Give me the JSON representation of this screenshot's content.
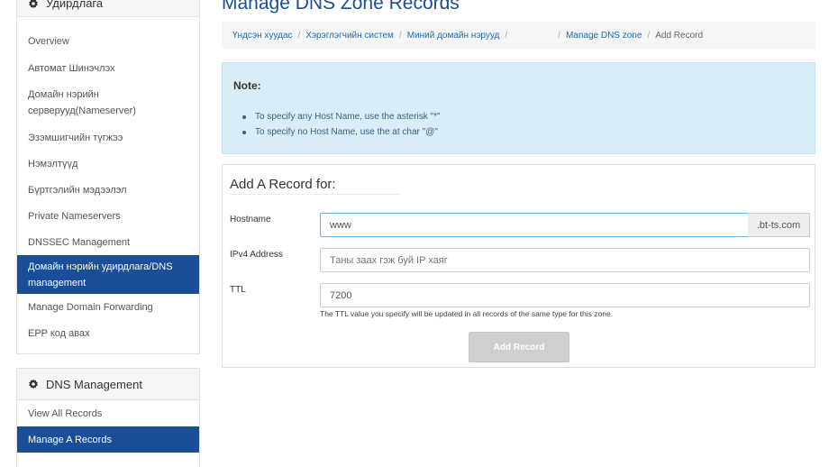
{
  "sidebar": {
    "panel1": {
      "title": "Удирдлага",
      "items": [
        {
          "label": "Overview"
        },
        {
          "label": "Автомат Шинэчлэх"
        },
        {
          "label": "Домайн нэрийн серверууд(Nameserver)"
        },
        {
          "label": "Эзэмшигчийн түгжээ"
        },
        {
          "label": "Нэмэлтүүд"
        },
        {
          "label": "Бүртгэлийн мэдээлэл"
        },
        {
          "label": "Private Nameservers"
        },
        {
          "label": "DNSSEC Management"
        },
        {
          "label": "Домайн нэрийн удирдлага/DNS management",
          "active": true
        },
        {
          "label": "Manage Domain Forwarding"
        },
        {
          "label": "EPP код авах"
        }
      ]
    },
    "panel2": {
      "title": "DNS Management",
      "items": [
        {
          "label": "View All Records"
        },
        {
          "label": "Manage A Records",
          "active": true
        }
      ]
    }
  },
  "main": {
    "title": "Manage DNS Zone Records",
    "breadcrumb": [
      "Үндсэн хуудас",
      "Хэрэглэгчийн систем",
      "Миний домайн нэрууд",
      "",
      "Manage DNS zone",
      "Add Record"
    ],
    "note": {
      "title": "Note:",
      "items": [
        "To specify any Host Name, use the asterisk \"*\"",
        "To specify no Host Name, use the at char \"@\""
      ]
    },
    "form": {
      "title": "Add A Record for:",
      "hostname_label": "Hostname",
      "hostname_value": "www",
      "domain_suffix": ".bt-ts.com",
      "ipv4_label": "IPv4 Address",
      "ipv4_placeholder": "Таны заах гэж буй IP хаяг",
      "ttl_label": "TTL",
      "ttl_value": "7200",
      "ttl_help": "The TTL value you specify will be updated in all records of the same type for this zone.",
      "submit_label": "Add Record"
    }
  },
  "colors": {
    "accent": "#1a4e96",
    "link": "#1a6bb5",
    "note_bg": "#d9edf7",
    "button_disabled": "#cfcfcf"
  },
  "icons": {
    "panel_icon": "gear-icon"
  }
}
